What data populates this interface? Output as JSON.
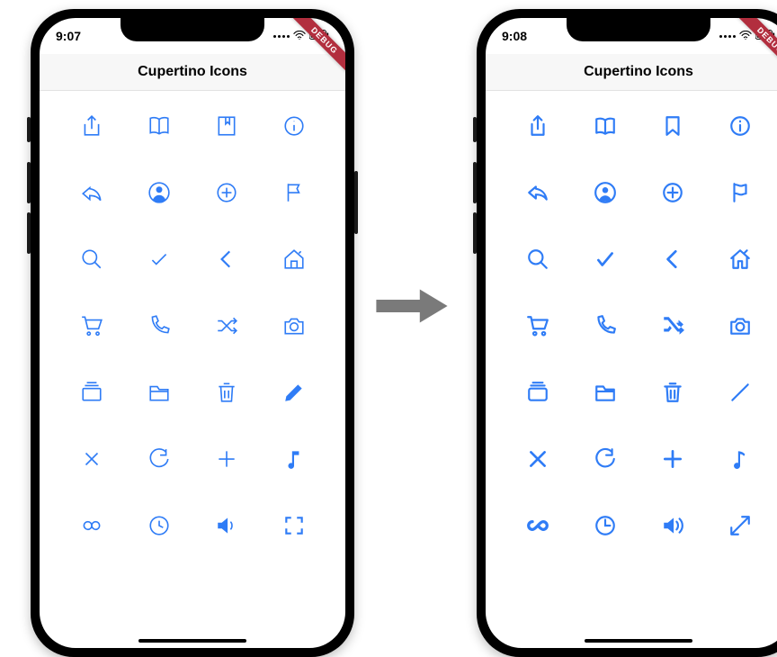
{
  "banner": "DEBUG",
  "left": {
    "time": "9:07",
    "title": "Cupertino Icons",
    "icons": [
      "share",
      "book",
      "bookmark",
      "info",
      "reply",
      "person-circle",
      "add-circle",
      "flag",
      "search",
      "check",
      "chevron-left",
      "home",
      "cart",
      "phone",
      "shuffle",
      "camera",
      "collections",
      "folder",
      "delete",
      "pencil",
      "clear",
      "refresh",
      "add",
      "music-note",
      "loop",
      "time",
      "volume-up",
      "fullscreen"
    ]
  },
  "right": {
    "time": "9:08",
    "title": "Cupertino Icons",
    "icons": [
      "share",
      "book",
      "bookmark",
      "info",
      "reply",
      "person-circle",
      "add-circle",
      "flag",
      "search",
      "check",
      "chevron-left",
      "home",
      "cart",
      "phone",
      "shuffle",
      "camera",
      "collections",
      "folder",
      "delete",
      "pencil",
      "clear",
      "refresh",
      "add",
      "music-note",
      "loop",
      "time",
      "volume-up",
      "fullscreen"
    ]
  }
}
